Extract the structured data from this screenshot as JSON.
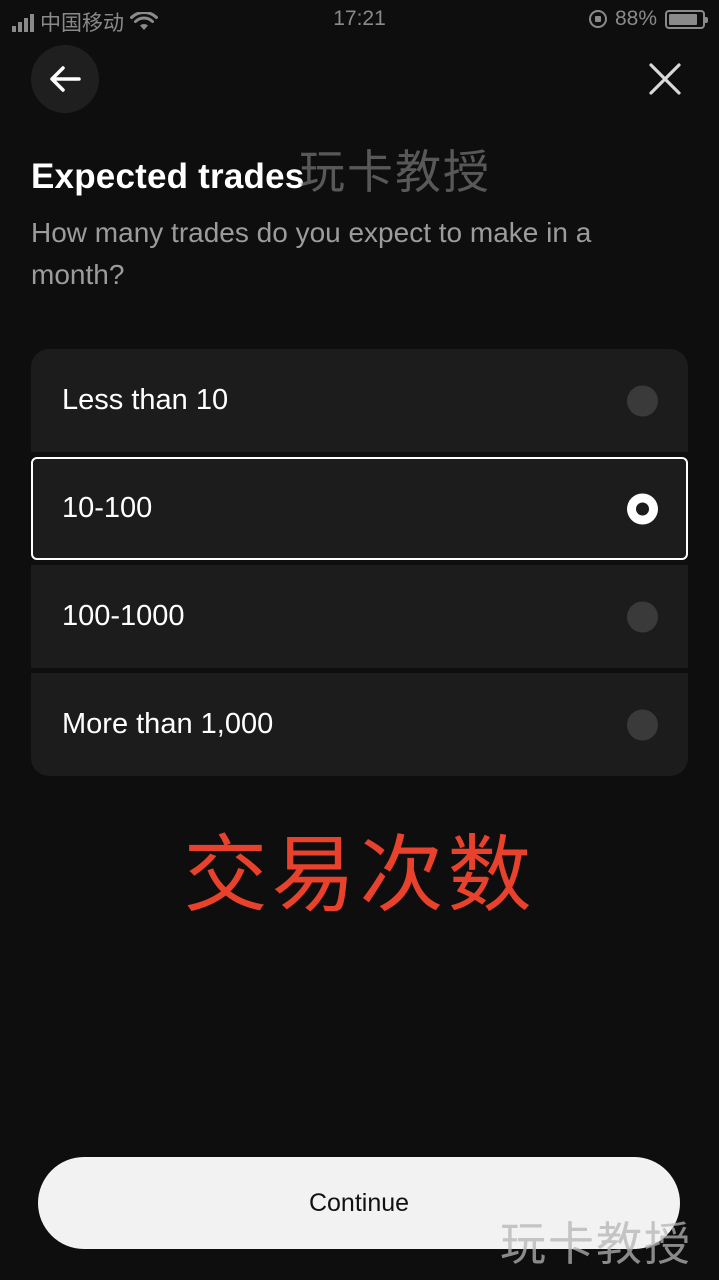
{
  "status_bar": {
    "carrier": "中国移动",
    "time": "17:21",
    "battery_percent": "88%",
    "battery_level": 0.88
  },
  "nav": {
    "back_icon": "arrow-left-icon",
    "close_icon": "close-icon"
  },
  "header": {
    "title": "Expected trades",
    "subtitle": "How many trades do you expect to make in a month?"
  },
  "options": [
    {
      "label": "Less than 10",
      "selected": false
    },
    {
      "label": "10-100",
      "selected": true
    },
    {
      "label": "100-1000",
      "selected": false
    },
    {
      "label": "More than 1,000",
      "selected": false
    }
  ],
  "annotation": "交易次数",
  "watermark": "玩卡教授",
  "footer": {
    "continue_label": "Continue"
  },
  "colors": {
    "background": "#0e0e0e",
    "card": "#1c1c1c",
    "annotation_red": "#e8412c",
    "button": "#f2f2f2"
  }
}
